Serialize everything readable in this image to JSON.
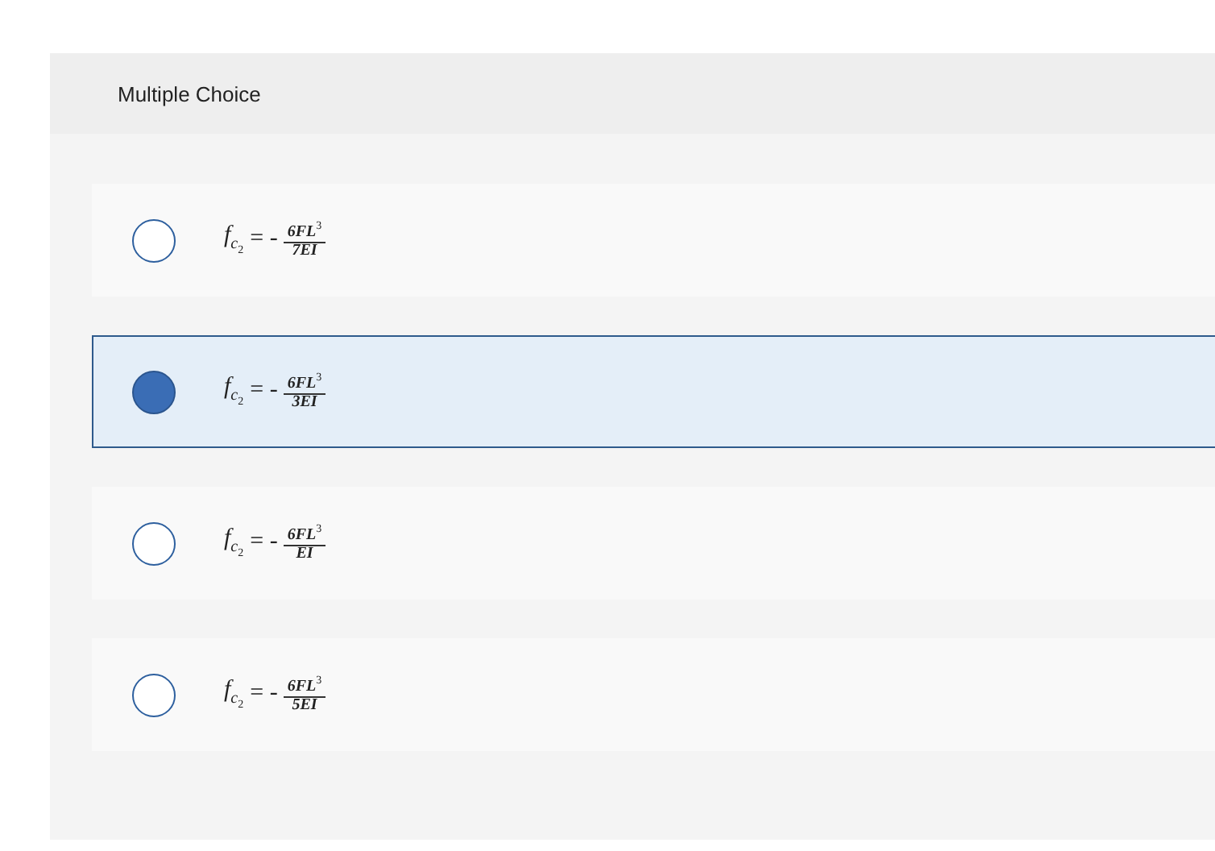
{
  "header": {
    "title": "Multiple Choice"
  },
  "options": [
    {
      "selected": false,
      "symbol": "f",
      "subscript": "c",
      "sub_subscript": "2",
      "sign": "= -",
      "numerator": "6FL$^{3}$",
      "denominator": "7EI"
    },
    {
      "selected": true,
      "symbol": "f",
      "subscript": "c",
      "sub_subscript": "2",
      "sign": "= -",
      "numerator": "6FL$^{3}$",
      "denominator": "3EI"
    },
    {
      "selected": false,
      "symbol": "f",
      "subscript": "c",
      "sub_subscript": "2",
      "sign": "= -",
      "numerator": "6FL$^{3}$",
      "denominator": "EI"
    },
    {
      "selected": false,
      "symbol": "f",
      "subscript": "c",
      "sub_subscript": "2",
      "sign": "= -",
      "numerator": "6FL$^{3}$",
      "denominator": "5EI"
    }
  ]
}
